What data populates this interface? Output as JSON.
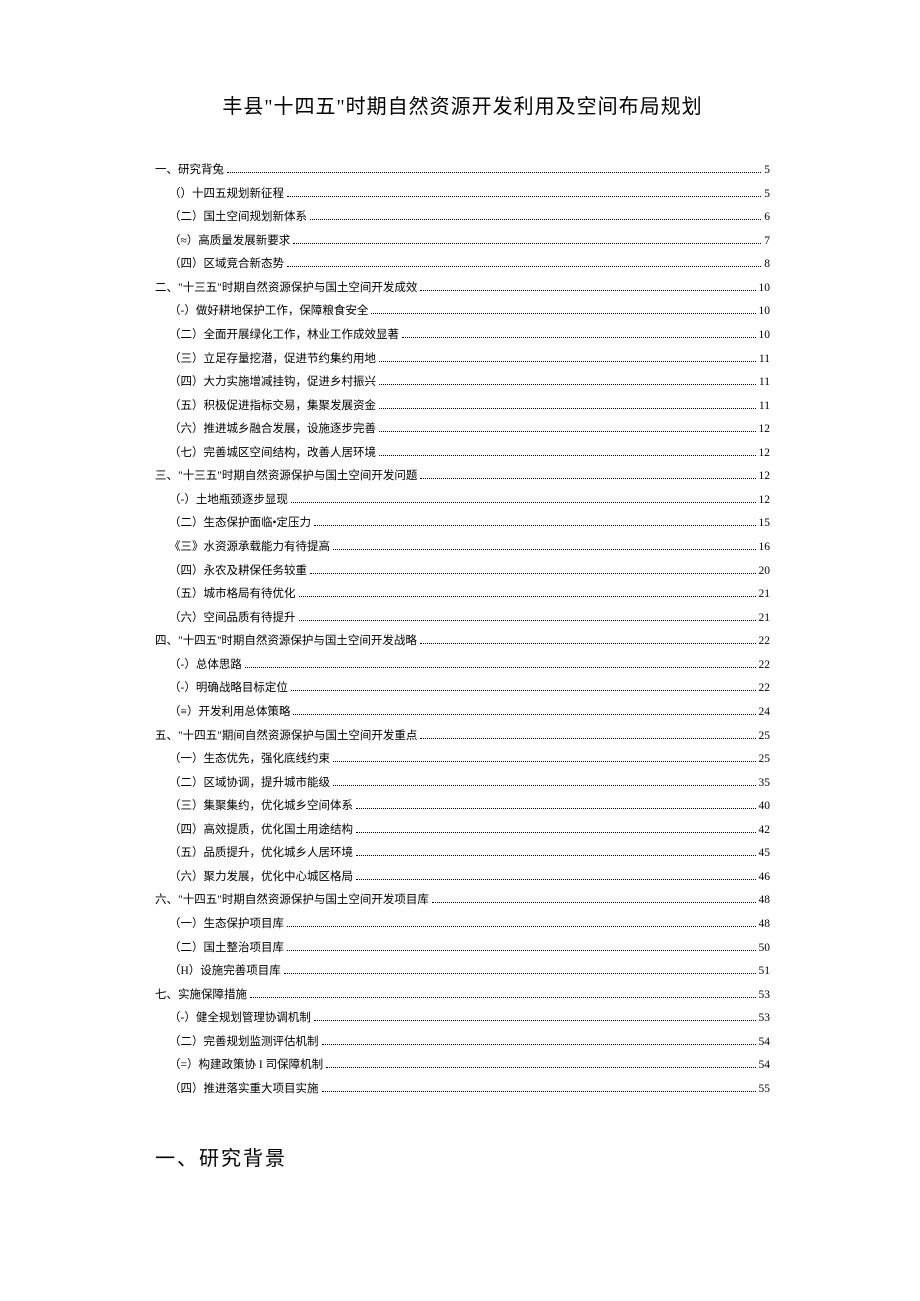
{
  "title": "丰县\"十四五\"时期自然资源开发利用及空间布局规划",
  "toc": [
    {
      "level": 1,
      "label": "一、研究背兔",
      "page": "5"
    },
    {
      "level": 2,
      "label": "（）十四五规划新征程",
      "page": "5"
    },
    {
      "level": 2,
      "label": "（二）国土空间规划新体系",
      "page": "6"
    },
    {
      "level": 2,
      "label": "（≈）高质量发展新要求",
      "page": "7"
    },
    {
      "level": 2,
      "label": "（四）区域竞合新态势",
      "page": "8"
    },
    {
      "level": 1,
      "label": "二、\"十三五\"时期自然资源保护与国土空间开发成效",
      "page": "10"
    },
    {
      "level": 2,
      "label": "（-）做好耕地保护工作，保障粮食安全",
      "page": "10"
    },
    {
      "level": 2,
      "label": "（二）全面开展绿化工作，林业工作成效显著",
      "page": "10"
    },
    {
      "level": 2,
      "label": "（三）立足存量挖潜，促进节约集约用地",
      "page": "11"
    },
    {
      "level": 2,
      "label": "（四）大力实施增减挂钩，促进乡村振兴",
      "page": "11"
    },
    {
      "level": 2,
      "label": "（五）积极促进指标交易，集聚发展资金",
      "page": "11"
    },
    {
      "level": 2,
      "label": "（六）推进城乡融合发展，设施逐步完善",
      "page": "12"
    },
    {
      "level": 2,
      "label": "（七）完善城区空间结构，改善人居环境",
      "page": "12"
    },
    {
      "level": 1,
      "label": "三、\"十三五\"时期自然资源保护与国土空间开发问题",
      "page": "12"
    },
    {
      "level": 2,
      "label": "（-）土地瓶颈逐步显现",
      "page": "12"
    },
    {
      "level": 2,
      "label": "（二）生态保护面临•定压力",
      "page": "15"
    },
    {
      "level": 2,
      "label": "《三》水资源承载能力有待提高",
      "page": "16"
    },
    {
      "level": 2,
      "label": "（四）永农及耕保任务较重",
      "page": "20"
    },
    {
      "level": 2,
      "label": "（五）城市格局有待优化",
      "page": "21"
    },
    {
      "level": 2,
      "label": "（六）空间品质有待提升",
      "page": "21"
    },
    {
      "level": 1,
      "label": "四、\"十四五''时期自然资源保护与国土空间开发战略",
      "page": "22"
    },
    {
      "level": 2,
      "label": "（-）总体思路",
      "page": "22"
    },
    {
      "level": 2,
      "label": "（-）明确战略目标定位",
      "page": "22"
    },
    {
      "level": 2,
      "label": "（≡）开发利用总体策略",
      "page": "24"
    },
    {
      "level": 1,
      "label": "五、\"十四五\"期间自然资源保护与国土空间开发重点",
      "page": "25"
    },
    {
      "level": 2,
      "label": "（一）生态优先，强化底线约束",
      "page": "25"
    },
    {
      "level": 2,
      "label": "（二）区域协调，提升城市能级",
      "page": "35"
    },
    {
      "level": 2,
      "label": "（三）集聚集约，优化城乡空间体系",
      "page": "40"
    },
    {
      "level": 2,
      "label": "（四）高效提质，优化国土用途结构",
      "page": "42"
    },
    {
      "level": 2,
      "label": "（五）品质提升，优化城乡人居环境",
      "page": "45"
    },
    {
      "level": 2,
      "label": "（六）聚力发展，优化中心城区格局",
      "page": "46"
    },
    {
      "level": 1,
      "label": "六、\"十四五\"时期自然资源保护与国土空间开发项目库",
      "page": "48"
    },
    {
      "level": 2,
      "label": "（一）生态保护项目库",
      "page": "48"
    },
    {
      "level": 2,
      "label": "（二）国土整治项目库",
      "page": "50"
    },
    {
      "level": 2,
      "label": "（H）设施完善项目库",
      "page": "51"
    },
    {
      "level": 1,
      "label": "七、实施保障措施",
      "page": "53"
    },
    {
      "level": 2,
      "label": "（-）健全规划管理协调机制",
      "page": "53"
    },
    {
      "level": 2,
      "label": "（二）完善规划监测评估机制",
      "page": "54"
    },
    {
      "level": 2,
      "label": "（=）构建政策协 I 司保障机制",
      "page": "54"
    },
    {
      "level": 2,
      "label": "（四）推进落实重大项目实施",
      "page": "55"
    }
  ],
  "section_heading": "一、研究背景"
}
